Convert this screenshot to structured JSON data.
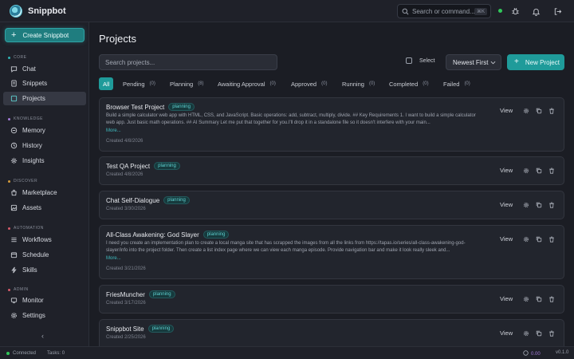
{
  "app": {
    "name": "Snippbot"
  },
  "topbar": {
    "search_placeholder": "Search or command...",
    "shortcut": "⌘K"
  },
  "sidebar": {
    "create_label": "Create Snippbot",
    "sections": {
      "core": "CORE",
      "knowledge": "KNOWLEDGE",
      "discover": "DISCOVER",
      "automation": "AUTOMATION",
      "admin": "ADMIN"
    },
    "items": {
      "chat": "Chat",
      "snippets": "Snippets",
      "projects": "Projects",
      "memory": "Memory",
      "history": "History",
      "insights": "Insights",
      "marketplace": "Marketplace",
      "assets": "Assets",
      "workflows": "Workflows",
      "schedule": "Schedule",
      "skills": "Skills",
      "monitor": "Monitor",
      "settings": "Settings"
    },
    "collapse_label": "‹"
  },
  "main": {
    "title": "Projects",
    "search_placeholder": "Search projects...",
    "select_label": "Select",
    "sort_label": "Newest First",
    "new_label": "New Project",
    "tabs": [
      {
        "label": "All",
        "count": ""
      },
      {
        "label": "Pending",
        "count": "(0)"
      },
      {
        "label": "Planning",
        "count": "(8)"
      },
      {
        "label": "Awaiting Approval",
        "count": "(0)"
      },
      {
        "label": "Approved",
        "count": "(0)"
      },
      {
        "label": "Running",
        "count": "(0)"
      },
      {
        "label": "Completed",
        "count": "(0)"
      },
      {
        "label": "Failed",
        "count": "(0)"
      }
    ],
    "view_label": "View",
    "more_label": "More...",
    "projects": [
      {
        "title": "Browser Test Project",
        "status": "planning",
        "desc": "Build a simple calculator web app with HTML, CSS, and JavaScript. Basic operations: add, subtract, multiply, divide. ## Key Requirements 1. I want to build a simple calculator web app. Just basic math operations. ## AI Summary Let me put that together for you.I'll drop it in a standalone file so it doesn't interfere with your main...",
        "created": "Created 4/8/2026"
      },
      {
        "title": "Test QA Project",
        "status": "planning",
        "desc": "",
        "created": "Created 4/8/2026"
      },
      {
        "title": "Chat Self-Dialogue",
        "status": "planning",
        "desc": "",
        "created": "Created 3/30/2026"
      },
      {
        "title": "All-Class Awakening: God Slayer",
        "status": "planning",
        "desc": "I need you create an implementation plan to create a local manga site that has scrapped the images from all the links from https://tapas.io/series/all-class-awakening-god-slayer/info into the project folder. Then create a list index page where we can view each manga episode. Provide navigation bar and make it look really sleek and...",
        "created": "Created 3/21/2026"
      },
      {
        "title": "FriesMuncher",
        "status": "planning",
        "desc": "",
        "created": "Created 3/17/2026"
      },
      {
        "title": "Snippbot Site",
        "status": "planning",
        "desc": "",
        "created": "Created 2/25/2026"
      }
    ]
  },
  "statusbar": {
    "connection": "Connected",
    "tasks": "Tasks: 0",
    "cost": "0.00",
    "version": "v0.1.0"
  },
  "colors": {
    "accent": "#1f9b9a",
    "connected": "#31c75a",
    "cost": "#a27bd8"
  }
}
